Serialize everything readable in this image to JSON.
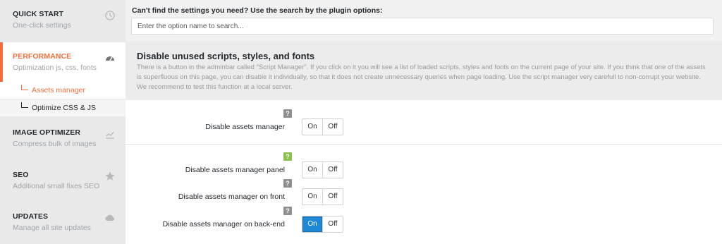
{
  "sidebar": {
    "items": [
      {
        "title": "QUICK START",
        "subtitle": "One-click settings",
        "icon": "clock-icon"
      },
      {
        "title": "PERFORMANCE",
        "subtitle": "Optimization js, css, fonts",
        "icon": "dashboard-icon"
      },
      {
        "title": "IMAGE OPTIMIZER",
        "subtitle": "Compress bulk of images",
        "icon": "chart-icon"
      },
      {
        "title": "SEO",
        "subtitle": "Additional small fixes SEO",
        "icon": "star-icon"
      },
      {
        "title": "UPDATES",
        "subtitle": "Manage all site updates",
        "icon": "cloud-icon"
      }
    ],
    "subitems": [
      {
        "label": "Assets manager"
      },
      {
        "label": "Optimize CSS & JS"
      }
    ]
  },
  "search": {
    "label": "Can't find the settings you need? Use the search by the plugin options:",
    "placeholder": "Enter the option name to search..."
  },
  "panel": {
    "title": "Disable unused scripts, styles, and fonts",
    "description": "There is a button in the adminbar called \"Script Manager\". If you click on it you will see a list of loaded scripts, styles and fonts on the current page of your site. If you think that one of the assets is superfluous on this page, you can disable it individually, so that it does not create unnecessary queries when page loading. Use the script manager very carefull to non-corrupt your website. We recommend to test this function at a local server."
  },
  "settings": [
    {
      "label": "Disable assets manager",
      "on": "On",
      "off": "Off",
      "help": "?"
    },
    {
      "label": "Disable assets manager panel",
      "on": "On",
      "off": "Off",
      "help": "?"
    },
    {
      "label": "Disable assets manager on front",
      "on": "On",
      "off": "Off",
      "help": "?"
    },
    {
      "label": "Disable assets manager on back-end",
      "on": "On",
      "off": "Off",
      "help": "?"
    }
  ],
  "colors": {
    "accent": "#f66d3b",
    "toggle_on": "#1e88d6",
    "help_green": "#8cc152"
  }
}
